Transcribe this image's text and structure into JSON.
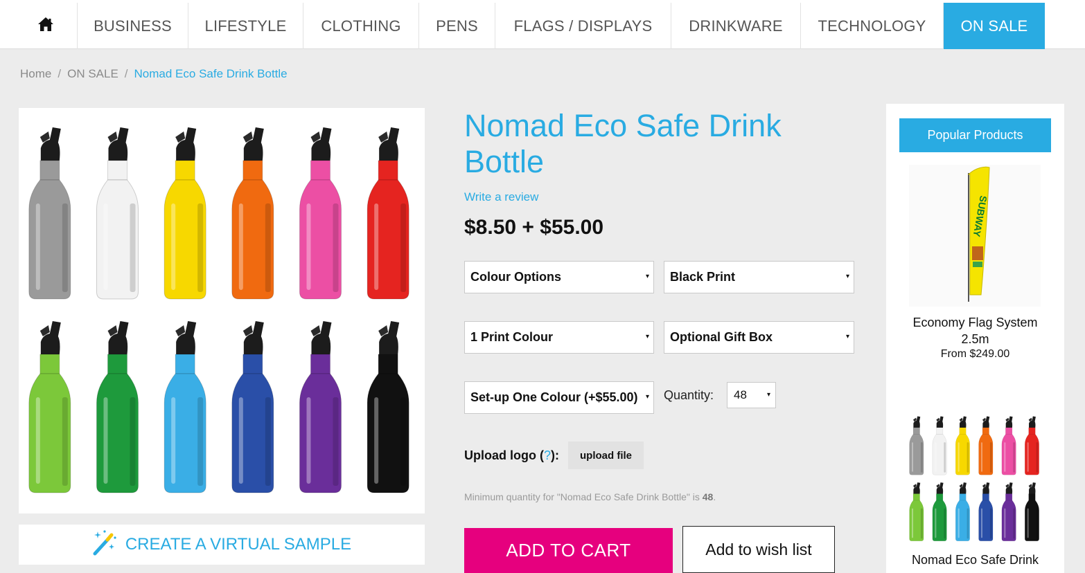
{
  "nav": {
    "home_icon": "home-icon",
    "items": [
      "BUSINESS",
      "LIFESTYLE",
      "CLOTHING",
      "PENS",
      "FLAGS / DISPLAYS",
      "DRINKWARE",
      "TECHNOLOGY",
      "ON SALE"
    ],
    "active_color": "#29abe2"
  },
  "breadcrumb": {
    "home": "Home",
    "sep": "/",
    "category": "ON SALE",
    "current": "Nomad Eco Safe Drink Bottle"
  },
  "product": {
    "title": "Nomad Eco Safe Drink Bottle",
    "review_link": "Write a review",
    "price": "$8.50 + $55.00",
    "bottle_colors": [
      "#9a9a9a",
      "#f2f2f2",
      "#f7d800",
      "#f06a10",
      "#ec4fa4",
      "#e52420",
      "#7cc83a",
      "#1e9a3c",
      "#3aaee6",
      "#2a4fa8",
      "#6a2e9a",
      "#111111"
    ],
    "virtual_sample": "CREATE A VIRTUAL SAMPLE",
    "wand_icon": "magic-wand-icon"
  },
  "options": {
    "colour": "Colour Options",
    "print": "Black Print",
    "print_colours": "1 Print Colour",
    "gift_box": "Optional Gift Box",
    "setup": "Set-up One Colour (+$55.00)",
    "caret": "▾"
  },
  "quantity": {
    "label": "Quantity:",
    "value": "48"
  },
  "upload": {
    "label_start": "Upload logo (",
    "help": "?",
    "label_end": "):",
    "button": "upload file"
  },
  "minimum_note": {
    "text": "Minimum quantity for \"Nomad Eco Safe Drink Bottle\" is ",
    "value": "48",
    "end": "."
  },
  "actions": {
    "add_to_cart": "ADD TO CART",
    "wishlist": "Add to wish list",
    "cart_color": "#e6007e"
  },
  "sidebar": {
    "header": "Popular Products",
    "products": [
      {
        "name": "Economy Flag System 2.5m",
        "price": "From $249.00",
        "flag_text": "SUBWAY"
      },
      {
        "name": "Nomad Eco Safe Drink"
      }
    ]
  }
}
